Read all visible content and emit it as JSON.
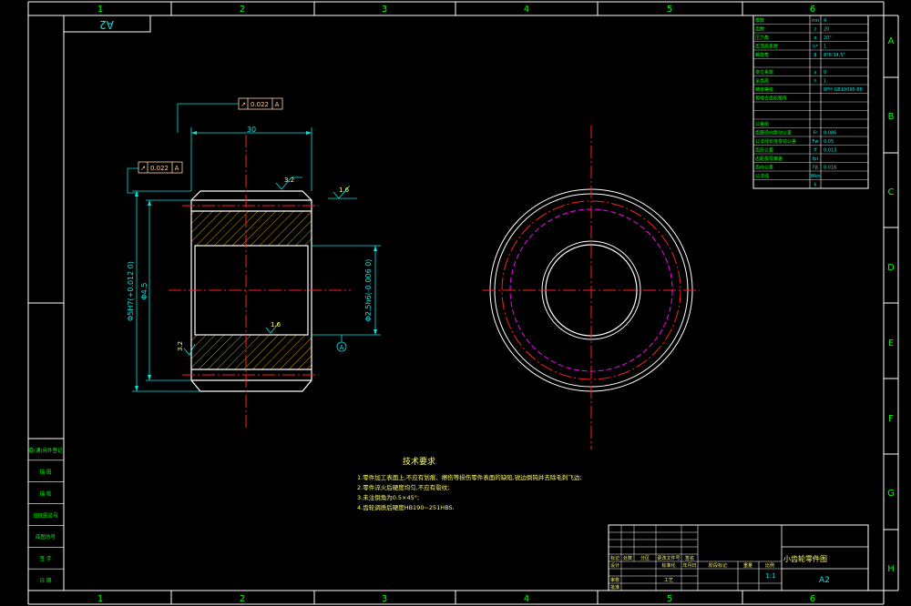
{
  "colors": {
    "frame": "#ffffff",
    "outline": "#ffffff",
    "center_line": "#ff2020",
    "dimension": "#00e5e5",
    "annotation": "#ffff66",
    "text_green": "#00ff00",
    "hatch": "#c8a000",
    "pitch_circle": "#ff00ff",
    "tolerance_box": "#ffd0a0"
  },
  "zone_columns": [
    "1",
    "2",
    "3",
    "4",
    "5",
    "6"
  ],
  "zone_rows": [
    "A",
    "B",
    "C",
    "D",
    "E",
    "F",
    "G",
    "H"
  ],
  "format_label_topleft": "A2",
  "tolerance_top": {
    "symbol": "↗",
    "value": "0.022",
    "datum": "A"
  },
  "tolerance_left": {
    "symbol": "↗",
    "value": "0.022",
    "datum": "A"
  },
  "dimensions": {
    "face_width": "30",
    "outer_diameter": "Φ4.5",
    "outer_fit": "Φ5H7(+0.012 0)",
    "bore": "Φ2.5h6(-0.006 0)",
    "datum_label": "A"
  },
  "roughness": {
    "top_face": "3.2",
    "right": "1.6",
    "bore_inner": "1.6",
    "bottom_left": "3.2"
  },
  "params_table": [
    {
      "name": "模数",
      "sym": "mn",
      "val": "4"
    },
    {
      "name": "齿数",
      "sym": "z",
      "val": "20"
    },
    {
      "name": "压力角",
      "sym": "α",
      "val": "20°"
    },
    {
      "name": "齿顶高系数",
      "sym": "h*",
      "val": "1"
    },
    {
      "name": "螺旋角",
      "sym": "β",
      "val": "8°6'34.5\""
    },
    {
      "name": "",
      "sym": "",
      "val": ""
    },
    {
      "name": "变位系数",
      "sym": "x",
      "val": "0"
    },
    {
      "name": "全齿高",
      "sym": "h",
      "val": "1"
    },
    {
      "name": "精度等级",
      "sym": "",
      "val": "8FH GB10095-88"
    },
    {
      "name": "相啮合齿轮图号",
      "sym": "",
      "val": ""
    },
    {
      "name": "",
      "sym": "",
      "val": ""
    },
    {
      "name": "",
      "sym": "",
      "val": ""
    },
    {
      "name": "公差组",
      "sym": "",
      "val": ""
    },
    {
      "name": "齿圈径向跳动公差",
      "sym": "Fr",
      "val": "0.086"
    },
    {
      "name": "公法线长度变动公差",
      "sym": "Fw",
      "val": "0.05"
    },
    {
      "name": "齿形公差",
      "sym": "ff",
      "val": "0.013"
    },
    {
      "name": "齿距极限偏差",
      "sym": "fpt",
      "val": ""
    },
    {
      "name": "齿向公差",
      "sym": "Fβ",
      "val": "0.016"
    },
    {
      "name": "公法线",
      "sym": "Wkn",
      "val": ""
    },
    {
      "name": "",
      "sym": "k",
      "val": ""
    }
  ],
  "notes": {
    "title": "技术要求",
    "lines": [
      "1.零件加工表面上,不应有划痕、擦伤等损伤零件表面的缺陷,锐边倒钝并去除毛刺飞边;",
      "2.零件淬火后硬度均匀,不应有裂纹;",
      "3.未注倒角为0.5×45°;",
      "4.齿轮调质后硬度HB190~251HBS."
    ]
  },
  "side_stamp": [
    "借(通)用件登记",
    "描 图",
    "描 校",
    "旧底图总号",
    "底图总号",
    "签 字",
    "日 期"
  ],
  "title_block": {
    "part_name": "小齿轮零件图",
    "scale": "1:1",
    "sheet_size": "A2",
    "labels": [
      "标记",
      "处数",
      "分区",
      "更改文件号",
      "签名",
      "年月日",
      "设计",
      "标准化",
      "阶段标记",
      "重量",
      "比例",
      "审核",
      "工艺",
      "批准"
    ]
  }
}
